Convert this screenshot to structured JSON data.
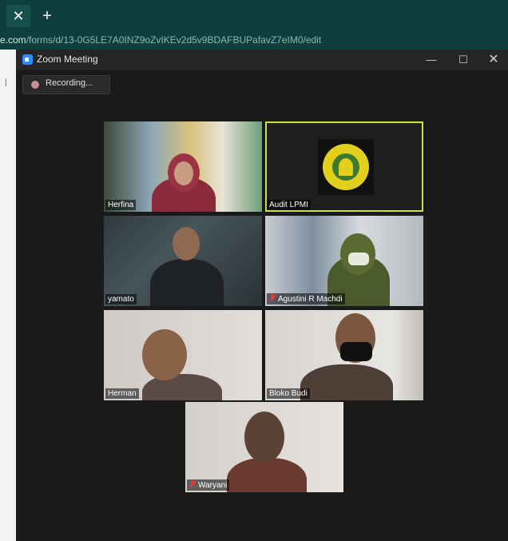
{
  "browser": {
    "tab_close_glyph": "✕",
    "new_tab_glyph": "+",
    "url_host": "e.com",
    "url_path": "/forms/d/13-0G5LE7A0INZ9oZvIKEv2d5v9BDAFBUPafavZ7eIM0/edit"
  },
  "zoom": {
    "title": "Zoom Meeting",
    "window_buttons": {
      "minimize": "—",
      "maximize": "☐",
      "close": "✕"
    },
    "recording_label": "Recording...",
    "participants": [
      {
        "name": "Herfina",
        "muted": false,
        "active": false
      },
      {
        "name": "Audit LPMI",
        "muted": false,
        "active": true
      },
      {
        "name": "yamato",
        "muted": false,
        "active": false
      },
      {
        "name": "Agustini R Machdi",
        "muted": true,
        "active": false
      },
      {
        "name": "Herman",
        "muted": false,
        "active": false
      },
      {
        "name": "Bloko Budi",
        "muted": false,
        "active": false
      },
      {
        "name": "Waryani",
        "muted": true,
        "active": false
      }
    ]
  },
  "colors": {
    "browser_bar": "#0f3f3c",
    "zoom_bg": "#1a1a1a",
    "active_speaker_border": "#c9e04a",
    "muted_red": "#e03c3c"
  }
}
